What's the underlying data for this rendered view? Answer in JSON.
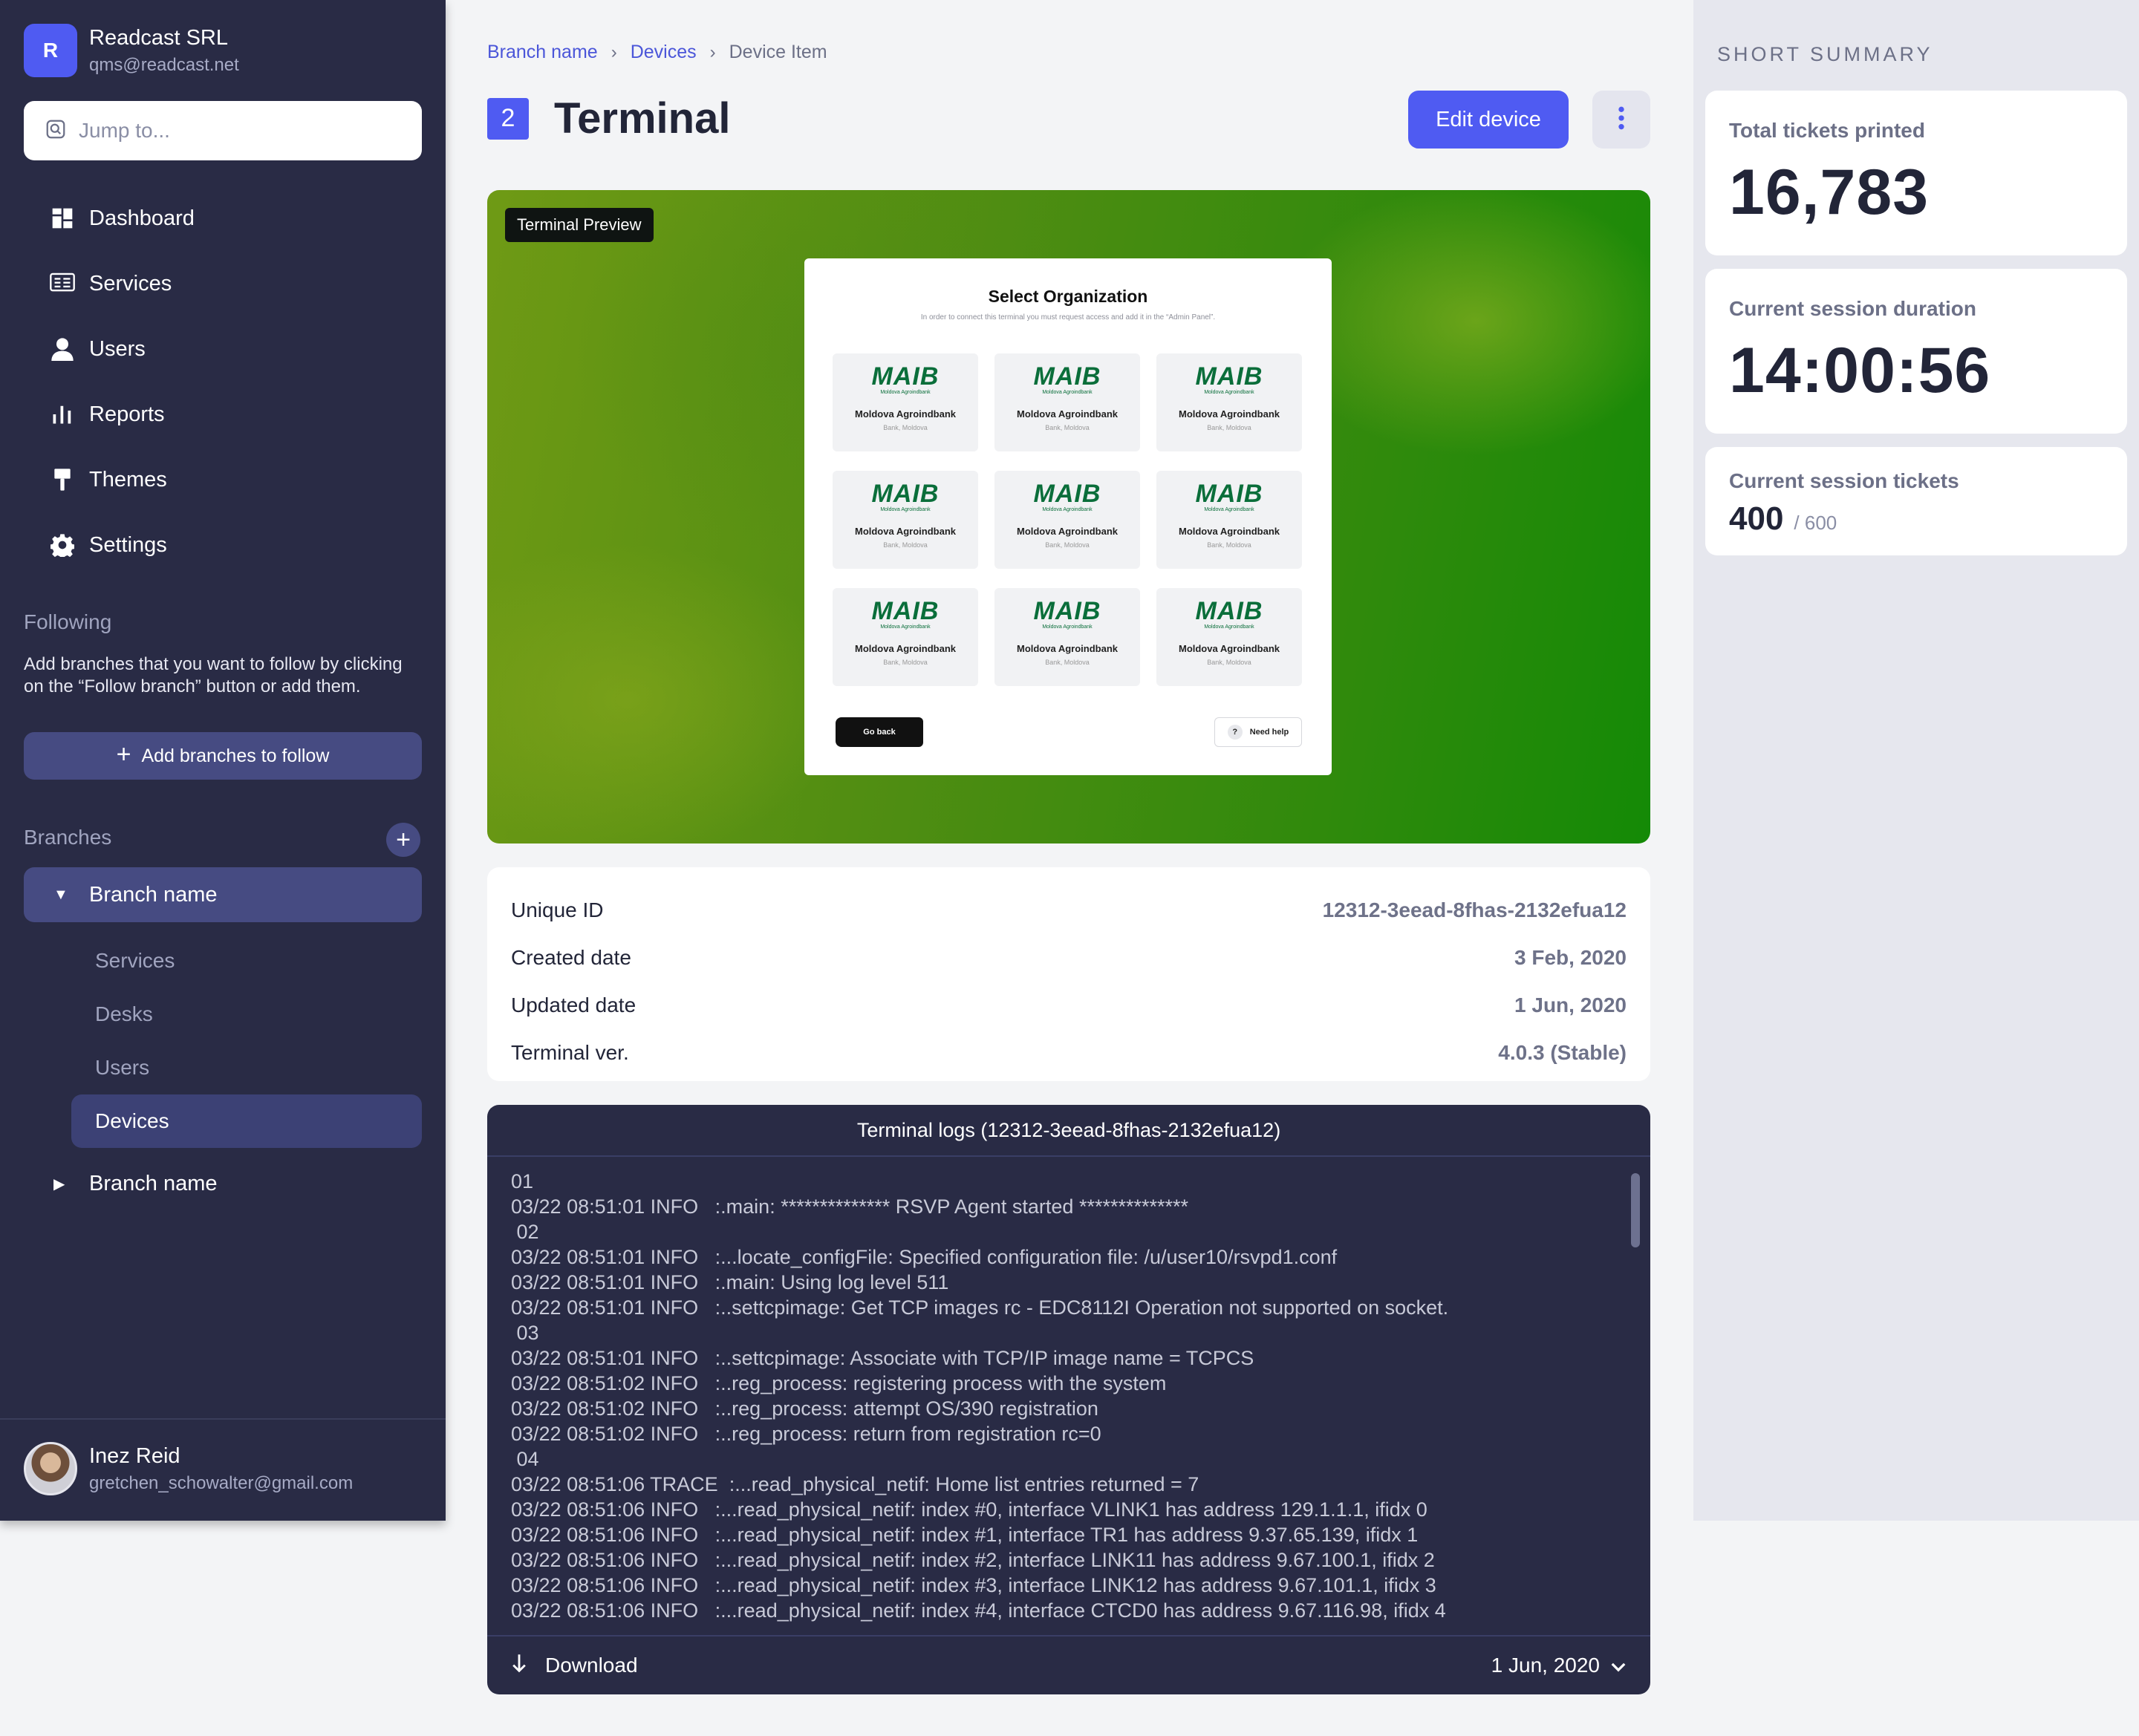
{
  "org": {
    "initial": "R",
    "name": "Readcast SRL",
    "email": "qms@readcast.net"
  },
  "search": {
    "placeholder": "Jump to..."
  },
  "nav": [
    {
      "label": "Dashboard",
      "icon": "dashboard-icon"
    },
    {
      "label": "Services",
      "icon": "services-icon"
    },
    {
      "label": "Users",
      "icon": "user-icon"
    },
    {
      "label": "Reports",
      "icon": "reports-icon"
    },
    {
      "label": "Themes",
      "icon": "paint-roller-icon"
    },
    {
      "label": "Settings",
      "icon": "gear-icon"
    }
  ],
  "following": {
    "title": "Following",
    "description": "Add branches that you want to follow by clicking on the “Follow branch” button or add them.",
    "add_label": "Add branches to follow"
  },
  "branches": {
    "title": "Branches",
    "open": {
      "name": "Branch name",
      "items": [
        "Services",
        "Desks",
        "Users"
      ],
      "active": "Devices"
    },
    "closed": {
      "name": "Branch name"
    }
  },
  "user": {
    "name": "Inez Reid",
    "email": "gretchen_schowalter@gmail.com"
  },
  "breadcrumb": {
    "first": "Branch name",
    "second": "Devices",
    "current": "Device Item"
  },
  "page": {
    "badge": "2",
    "title": "Terminal",
    "edit_label": "Edit device"
  },
  "preview": {
    "tag": "Terminal Preview",
    "kiosk_title": "Select Organization",
    "kiosk_subtitle": "In order to connect this terminal you must request access and add it in the “Admin Panel”.",
    "org_logo": "MAIB",
    "org_logo_sub": "Moldova Agroindbank",
    "org_name": "Moldova Agroindbank",
    "org_location": "Bank, Moldova",
    "go_back": "Go back",
    "need_help": "Need help"
  },
  "details": [
    {
      "label": "Unique ID",
      "value": "12312-3eead-8fhas-2132efua12"
    },
    {
      "label": "Created date",
      "value": "3 Feb, 2020"
    },
    {
      "label": "Updated date",
      "value": "1 Jun, 2020"
    },
    {
      "label": "Terminal ver.",
      "value": "4.0.3 (Stable)"
    }
  ],
  "logs": {
    "title": "Terminal logs (12312-3eead-8fhas-2132efua12)",
    "lines": [
      "01",
      "03/22 08:51:01 INFO   :.main: ************** RSVP Agent started **************",
      " 02",
      "03/22 08:51:01 INFO   :...locate_configFile: Specified configuration file: /u/user10/rsvpd1.conf",
      "03/22 08:51:01 INFO   :.main: Using log level 511",
      "03/22 08:51:01 INFO   :..settcpimage: Get TCP images rc - EDC8112I Operation not supported on socket.",
      " 03",
      "03/22 08:51:01 INFO   :..settcpimage: Associate with TCP/IP image name = TCPCS",
      "03/22 08:51:02 INFO   :..reg_process: registering process with the system",
      "03/22 08:51:02 INFO   :..reg_process: attempt OS/390 registration",
      "03/22 08:51:02 INFO   :..reg_process: return from registration rc=0",
      " 04",
      "03/22 08:51:06 TRACE  :...read_physical_netif: Home list entries returned = 7",
      "03/22 08:51:06 INFO   :...read_physical_netif: index #0, interface VLINK1 has address 129.1.1.1, ifidx 0",
      "03/22 08:51:06 INFO   :...read_physical_netif: index #1, interface TR1 has address 9.37.65.139, ifidx 1",
      "03/22 08:51:06 INFO   :...read_physical_netif: index #2, interface LINK11 has address 9.67.100.1, ifidx 2",
      "03/22 08:51:06 INFO   :...read_physical_netif: index #3, interface LINK12 has address 9.67.101.1, ifidx 3",
      "03/22 08:51:06 INFO   :...read_physical_netif: index #4, interface CTCD0 has address 9.67.116.98, ifidx 4"
    ],
    "download_label": "Download",
    "date": "1 Jun, 2020"
  },
  "summary": {
    "title": "SHORT SUMMARY",
    "total_label": "Total tickets printed",
    "total_value": "16,783",
    "duration_label": "Current session duration",
    "duration_value": "14:00:56",
    "tickets_label": "Current session tickets",
    "tickets_value": "400",
    "tickets_max": "/ 600"
  },
  "colors": {
    "accent": "#4f5bf2",
    "sidebar": "#292b45",
    "highlight": "#464b82"
  }
}
